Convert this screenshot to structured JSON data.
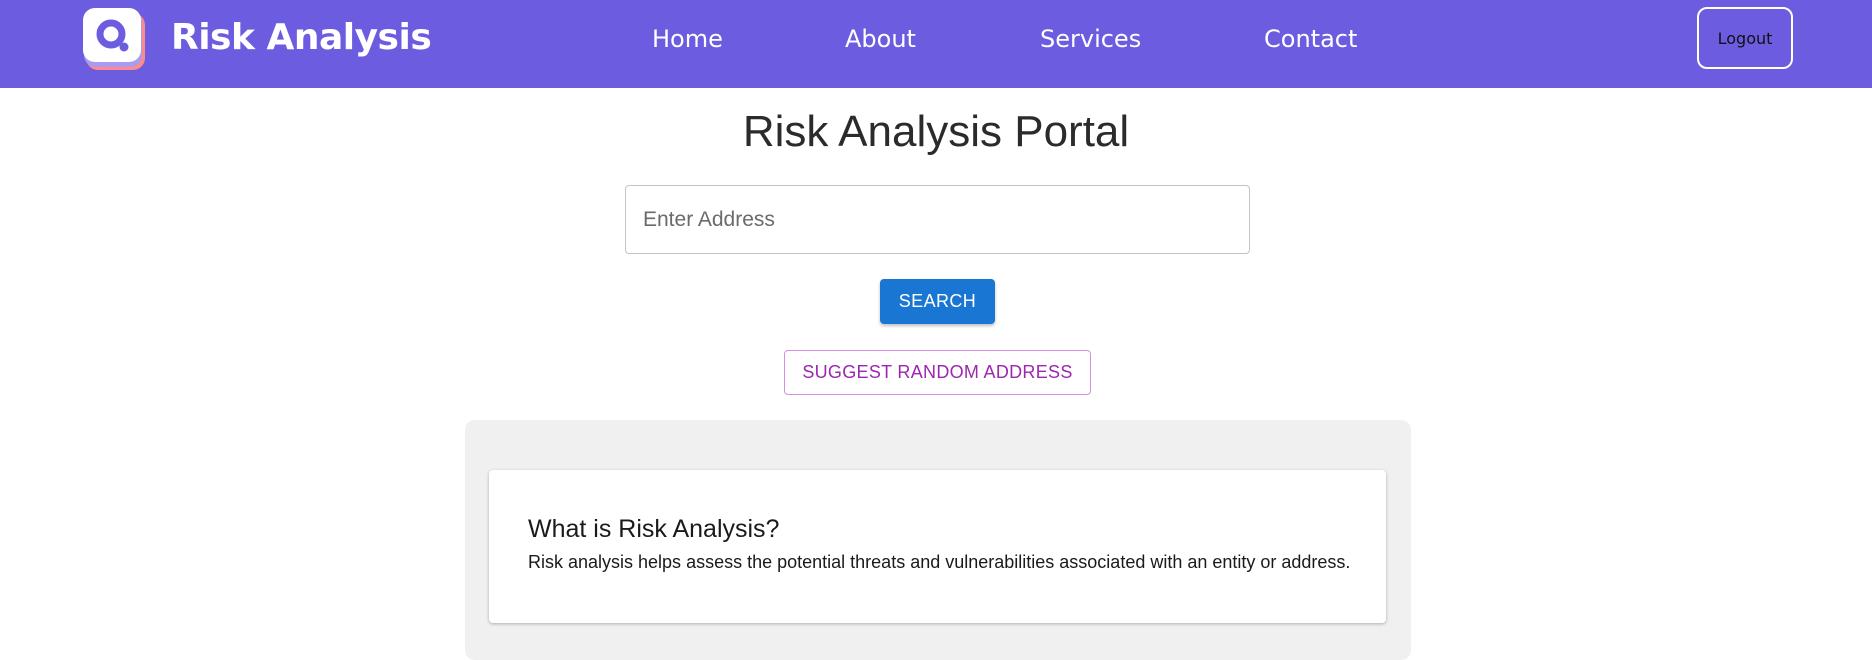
{
  "brand": {
    "name": "Risk Analysis",
    "logo_icon": "search-chat-icon"
  },
  "nav": {
    "links": [
      {
        "label": "Home"
      },
      {
        "label": "About"
      },
      {
        "label": "Services"
      },
      {
        "label": "Contact"
      }
    ],
    "logout_label": "Logout"
  },
  "main": {
    "title": "Risk Analysis Portal",
    "address_input": {
      "placeholder": "Enter Address",
      "value": ""
    },
    "search_label": "SEARCH",
    "suggest_label": "SUGGEST RANDOM ADDRESS"
  },
  "info": {
    "heading": "What is Risk Analysis?",
    "body": "Risk analysis helps assess the potential threats and vulnerabilities associated with an entity or address."
  },
  "colors": {
    "navbar": "#6c5ce0",
    "primary_button": "#1976d2",
    "secondary_button": "#9c27b0",
    "panel": "#f0f0f0"
  }
}
